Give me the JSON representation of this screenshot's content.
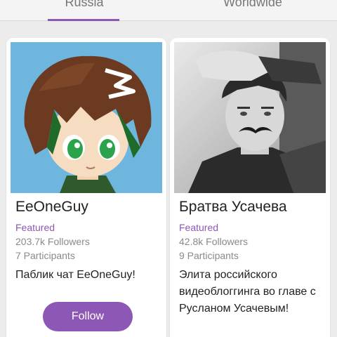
{
  "tabs": [
    {
      "label": "Russia",
      "active": true
    },
    {
      "label": "Worldwide",
      "active": false
    }
  ],
  "colors": {
    "accent": "#8c57b5",
    "background": "#ececec"
  },
  "cards": [
    {
      "name": "EeOneGuy",
      "featured": "Featured",
      "followers": "203.7k Followers",
      "participants": "7 Participants",
      "description": "Паблик чат EeOneGuy!",
      "follow_label": "Follow",
      "image": "cartoon-avatar"
    },
    {
      "name": "Братва Усачева",
      "featured": "Featured",
      "followers": "42.8k Followers",
      "participants": "9 Participants",
      "description": "Элита российского видеоблоггинга во главе с Русланом Усачевым!",
      "image": "mustache-photo"
    }
  ]
}
